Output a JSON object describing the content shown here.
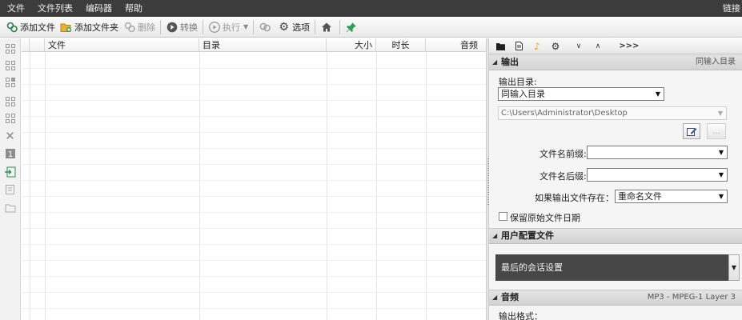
{
  "menu": [
    "文件",
    "文件列表",
    "编码器",
    "帮助"
  ],
  "menu_right": "链接",
  "toolbar": {
    "add_file": "添加文件",
    "add_folder": "添加文件夹",
    "delete": "删除",
    "convert": "转换",
    "execute": "执行",
    "options": "选项"
  },
  "table": {
    "columns": [
      "文件",
      "目录",
      "大小",
      "时长",
      "音频"
    ]
  },
  "panel": {
    "output_section": "输出",
    "output_section_value": "同输入目录",
    "output_dir_label": "输出目录:",
    "output_dir_value": "同输入目录",
    "path_value": "C:\\Users\\Administrator\\Desktop",
    "browse_label": "...",
    "prefix_label": "文件名前缀:",
    "prefix_value": "",
    "suffix_label": "文件名后缀:",
    "suffix_value": "",
    "exists_label": "如果输出文件存在：",
    "exists_value": "重命名文件",
    "keep_date_label": "保留原始文件日期",
    "profile_section": "用户配置文件",
    "profile_value": "最后的会话设置",
    "audio_section": "音频",
    "audio_section_value": "MP3 - MPEG-1 Layer 3",
    "output_format_label": "输出格式：",
    "tabs_more": ">>>"
  },
  "colors": {
    "menubar_bg": "#3c3c3c",
    "profile_bg": "#474747",
    "accent_green": "#2e8b57"
  }
}
